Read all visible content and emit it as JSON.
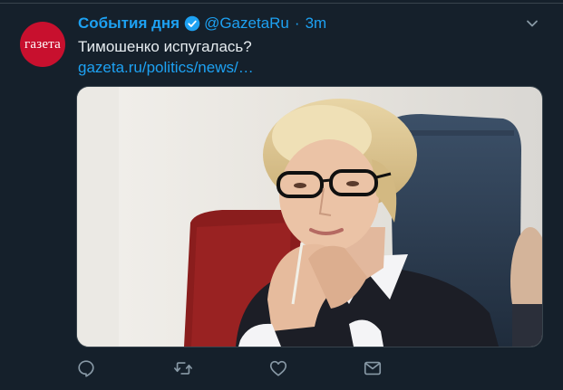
{
  "tweet": {
    "display_name": "События дня",
    "verified": true,
    "handle": "@GazetaRu",
    "separator": "·",
    "time": "3m",
    "text": "Тимошенко испугалась?",
    "link": "gazeta.ru/politics/news/…",
    "avatar_text": "газета"
  },
  "media": {
    "kind": "photo"
  },
  "actions": [
    {
      "name": "reply",
      "icon": "reply-icon"
    },
    {
      "name": "retweet",
      "icon": "retweet-icon"
    },
    {
      "name": "like",
      "icon": "heart-icon"
    },
    {
      "name": "dm",
      "icon": "mail-icon"
    }
  ],
  "colors": {
    "background": "#15202b",
    "accent": "#1da1f2",
    "text": "#e6ecf0",
    "muted": "#8899a6",
    "avatar": "#c8102e"
  }
}
